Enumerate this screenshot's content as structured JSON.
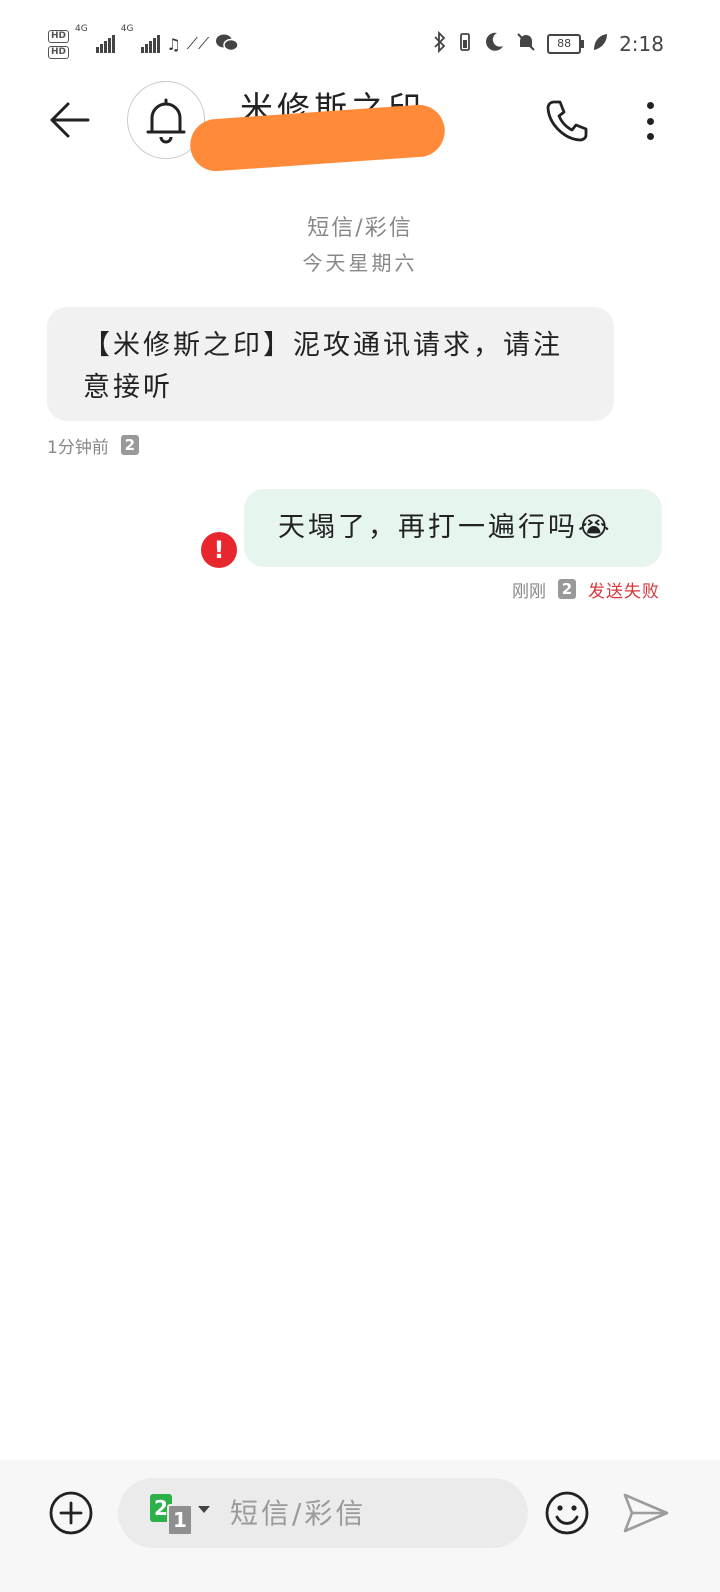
{
  "status_bar": {
    "hd1": "HD",
    "hd2": "HD",
    "net1": "4G",
    "net2": "4G",
    "battery": "88",
    "time": "2:18",
    "icons": [
      "bluetooth-icon",
      "vibrate-icon",
      "moon-icon",
      "mute-bell-icon",
      "leaf-icon"
    ]
  },
  "header": {
    "contact_name": "米修斯之印"
  },
  "conversation": {
    "type_label": "短信/彩信",
    "date_label": "今天星期六"
  },
  "messages": [
    {
      "direction": "incoming",
      "text": "【米修斯之印】泥攻通讯请求，请注意接听",
      "time": "1分钟前",
      "sim": "2"
    },
    {
      "direction": "outgoing",
      "text": "天塌了，再打一遍行吗😭",
      "time": "刚刚",
      "sim": "2",
      "status": "发送失败"
    }
  ],
  "composer": {
    "placeholder": "短信/彩信",
    "sim_primary": "2",
    "sim_secondary": "1"
  },
  "colors": {
    "incoming_bubble": "#f1f1f1",
    "outgoing_bubble": "#e6f6ee",
    "error": "#e8262d",
    "redaction": "#ff8a3a",
    "sim_green": "#2cb14a"
  }
}
